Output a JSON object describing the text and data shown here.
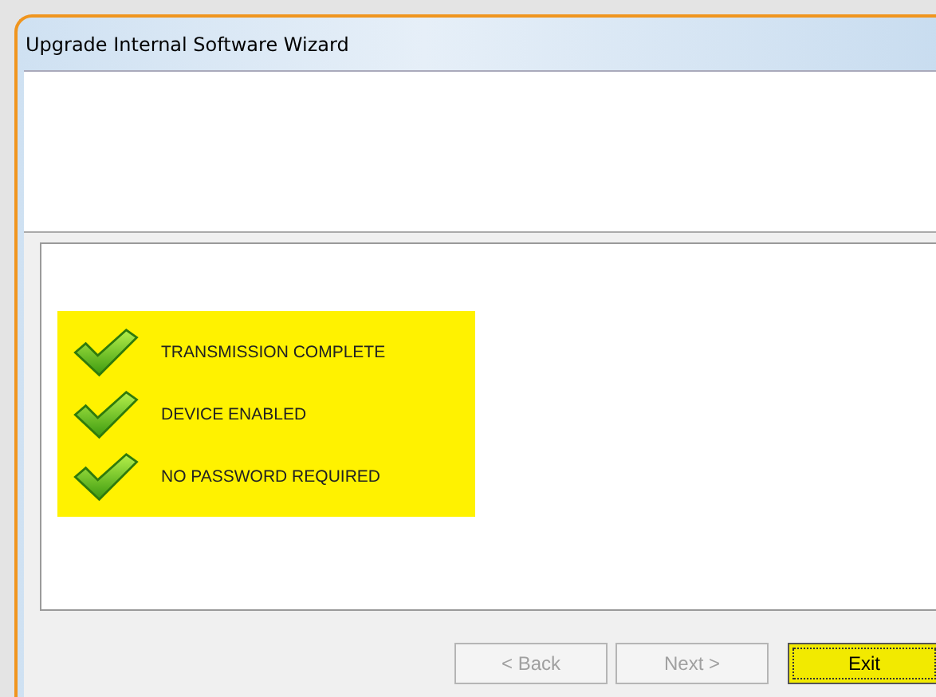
{
  "window": {
    "title": "Upgrade Internal Software Wizard"
  },
  "status_items": [
    {
      "text": "TRANSMISSION COMPLETE",
      "checked": true
    },
    {
      "text": "DEVICE ENABLED",
      "checked": true
    },
    {
      "text": "NO PASSWORD REQUIRED",
      "checked": true
    }
  ],
  "buttons": [
    {
      "label": "< Back",
      "disabled": true,
      "focused": false
    },
    {
      "label": "Next >",
      "disabled": true,
      "focused": false
    },
    {
      "label": "Exit",
      "disabled": false,
      "focused": true
    }
  ]
}
